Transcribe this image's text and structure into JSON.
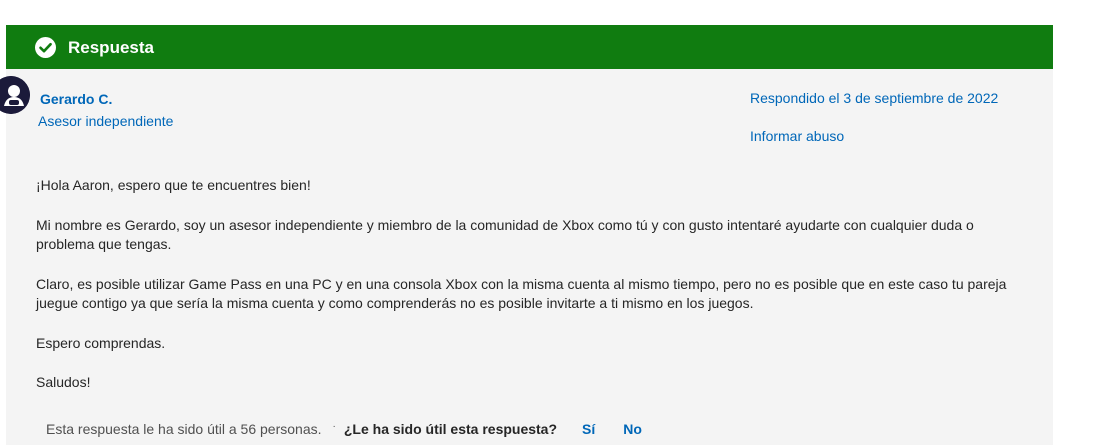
{
  "header": {
    "title": "Respuesta",
    "icon": "check-circle-icon",
    "background": "#107c10"
  },
  "author": {
    "name": "Gerardo C.",
    "role": "Asesor independiente",
    "avatar_icon": "gamer-avatar-icon"
  },
  "meta": {
    "answered": "Respondido el 3 de septiembre de 2022",
    "report_abuse": "Informar abuso"
  },
  "body": {
    "paragraphs": [
      "¡Hola Aaron, espero que te encuentres bien!",
      "Mi nombre es Gerardo, soy un asesor independiente y miembro de la comunidad de Xbox como tú y con gusto intentaré ayudarte con cualquier duda o problema que tengas.",
      "Claro, es posible utilizar Game Pass en una PC y en una consola Xbox con la misma cuenta al mismo tiempo, pero no es posible que en este caso tu pareja juegue contigo ya que sería la misma cuenta y como comprenderás no es posible invitarte a ti mismo en los juegos.",
      "Espero comprendas.",
      "Saludos!"
    ]
  },
  "footer": {
    "helpful_count": "Esta respuesta le ha sido útil a 56 personas.",
    "separator": "·",
    "question": "¿Le ha sido útil esta respuesta?",
    "yes_label": "Sí",
    "no_label": "No"
  },
  "colors": {
    "accent": "#0067b8",
    "card_background": "#f4f4f4"
  }
}
